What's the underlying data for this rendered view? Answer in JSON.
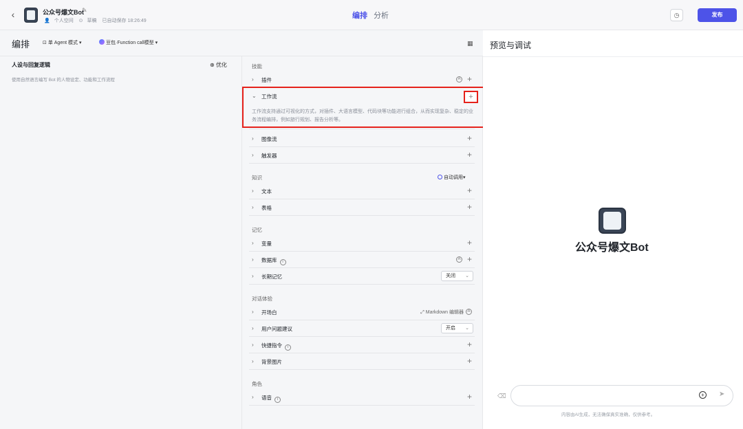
{
  "topbar": {
    "bot_name": "公众号爆文Bot",
    "space": "个人空间",
    "draft": "草稿",
    "autosave": "已自动保存 18:26:49",
    "tabs": [
      {
        "label": "编排"
      },
      {
        "label": "分析"
      }
    ],
    "publish": "发布"
  },
  "subheader": {
    "title": "编排",
    "mode": "单 Agent 模式",
    "model": "豆包·Function call模型"
  },
  "persona": {
    "title": "人设与回复逻辑",
    "optimize": "优化",
    "hint": "使用自然语言编写 Bot 的人物设定、功能和工作流程"
  },
  "skills": {
    "title": "技能",
    "plugin": "插件",
    "workflow": "工作流",
    "workflow_desc": "工作流支持通过可视化的方式，对插件、大语言模型、代码块等功能进行组合，从而实现复杂、稳定的业务流程编排，例如旅行规划、报告分析等。",
    "image_flow": "图像流",
    "trigger": "触发器"
  },
  "knowledge": {
    "title": "知识",
    "auto_call": "自动调用",
    "text": "文本",
    "table": "表格"
  },
  "memory": {
    "title": "记忆",
    "variable": "变量",
    "database": "数据库",
    "long_term": "长期记忆",
    "long_term_value": "关闭"
  },
  "dialog": {
    "title": "对话体验",
    "opening": "开场白",
    "opening_extra": "Markdown 编辑器",
    "suggest": "用户问题建议",
    "suggest_value": "开启",
    "shortcut": "快捷指令",
    "background": "背景图片"
  },
  "role": {
    "title": "角色",
    "voice": "语音"
  },
  "preview": {
    "title": "预览与调试",
    "bot_name": "公众号爆文Bot",
    "input_placeholder": "",
    "disclaimer": "内容由AI生成，无法确保真实准确，仅供参考。"
  }
}
